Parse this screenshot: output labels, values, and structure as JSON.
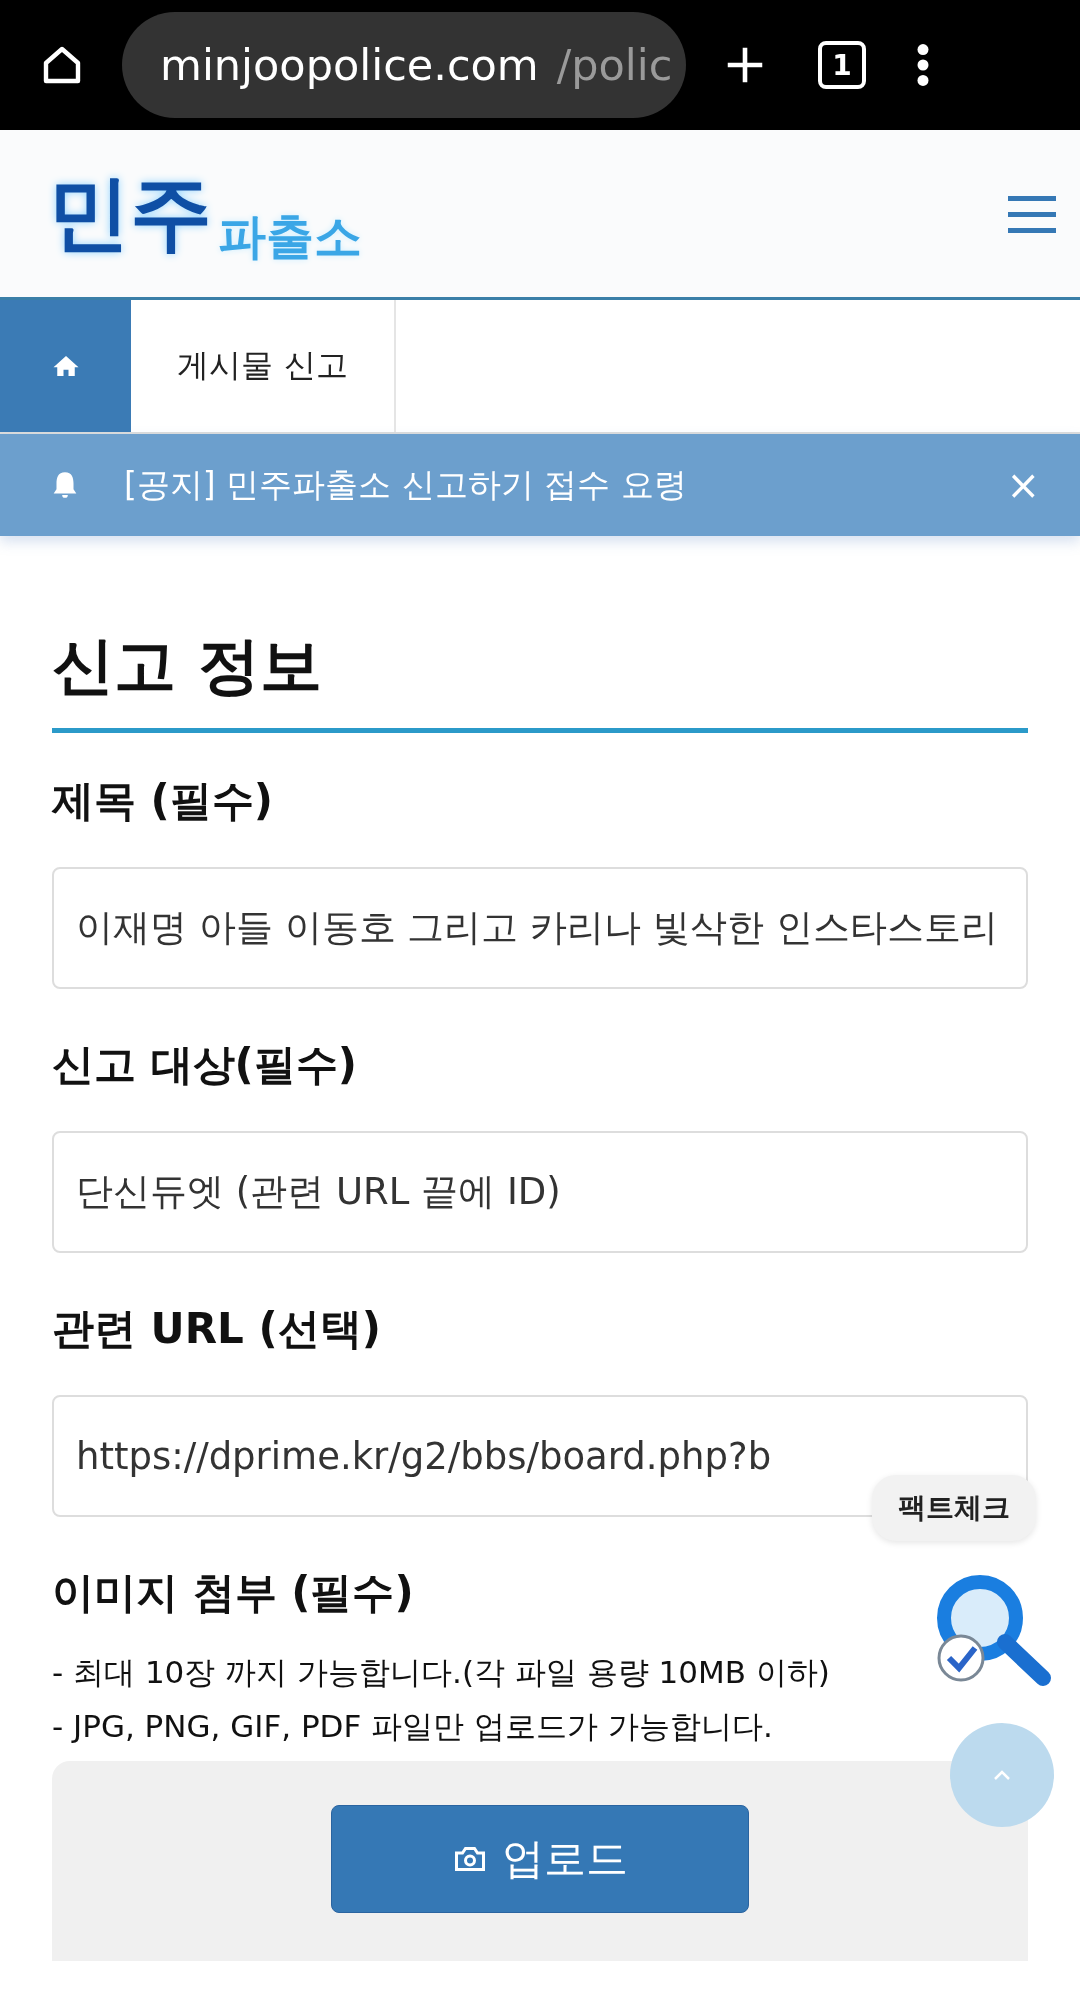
{
  "browser": {
    "url_host": "minjoopolice.com",
    "url_path": "/polic",
    "tab_count": "1"
  },
  "header": {
    "logo_main": "민주",
    "logo_sub": "파출소"
  },
  "breadcrumb": {
    "current": "게시물 신고"
  },
  "notice": {
    "text": "[공지] 민주파출소 신고하기 접수 요령",
    "close": "×"
  },
  "section_title": "신고 정보",
  "fields": [
    {
      "label": "제목 (필수)",
      "value": "이재명 아들 이동호 그리고 카리나 빛삭한 인스타스토리"
    },
    {
      "label": "신고 대상(필수)",
      "value": "단신듀엣 (관련 URL 끝에 ID)"
    },
    {
      "label": "관련 URL (선택)",
      "value": "https://dprime.kr/g2/bbs/board.php?b"
    }
  ],
  "attachment": {
    "label": "이미지 첨부 (필수)",
    "notes": [
      "- 최대 10장 까지 가능합니다.(각 파일 용량 10MB 이하)",
      "- JPG, PNG, GIF, PDF 파일만 업로드가 가능합니다."
    ],
    "upload_button": "업로드"
  },
  "floating": {
    "factcheck_label": "팩트체크"
  }
}
